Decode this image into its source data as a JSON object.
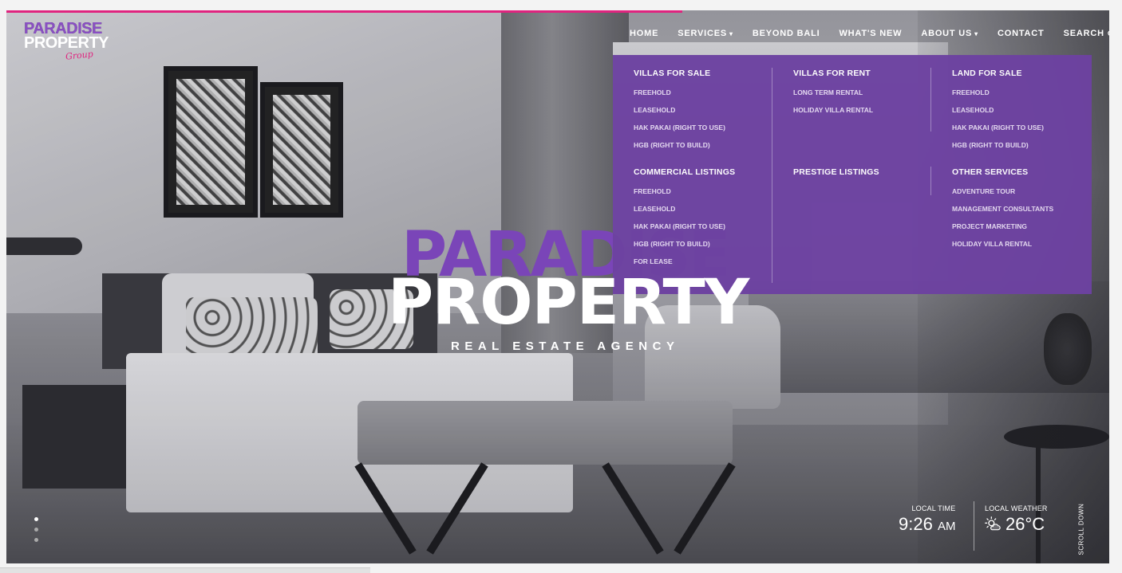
{
  "brand": {
    "line1": "PARADISE",
    "line2": "PROPERTY",
    "script": "Group"
  },
  "nav": {
    "items": [
      {
        "label": "HOME"
      },
      {
        "label": "SERVICES"
      },
      {
        "label": "BEYOND BALI"
      },
      {
        "label": "WHAT'S NEW"
      },
      {
        "label": "ABOUT US"
      },
      {
        "label": "CONTACT"
      },
      {
        "label": "SEARCH"
      }
    ]
  },
  "menu": {
    "villas_sale": {
      "title": "VILLAS FOR SALE",
      "links": [
        "FREEHOLD",
        "LEASEHOLD",
        "HAK PAKAI (RIGHT TO USE)",
        "HGB (RIGHT TO BUILD)"
      ]
    },
    "villas_rent": {
      "title": "VILLAS FOR RENT",
      "links": [
        "LONG TERM RENTAL",
        "HOLIDAY VILLA RENTAL"
      ]
    },
    "land_sale": {
      "title": "LAND FOR SALE",
      "links": [
        "FREEHOLD",
        "LEASEHOLD",
        "HAK PAKAI (RIGHT TO USE)",
        "HGB (RIGHT TO BUILD)"
      ]
    },
    "commercial": {
      "title": "COMMERCIAL LISTINGS",
      "links": [
        "FREEHOLD",
        "LEASEHOLD",
        "HAK PAKAI (RIGHT TO USE)",
        "HGB (RIGHT TO BUILD)",
        "FOR LEASE"
      ]
    },
    "prestige": {
      "title": "PRESTIGE LISTINGS"
    },
    "other": {
      "title": "OTHER SERVICES",
      "links": [
        "ADVENTURE TOUR",
        "MANAGEMENT CONSULTANTS",
        "PROJECT MARKETING",
        "HOLIDAY VILLA RENTAL"
      ]
    }
  },
  "hero": {
    "title_line1": "PARADISE",
    "title_line2": "PROPERTY",
    "subtitle": "REAL ESTATE AGENCY"
  },
  "widgets": {
    "time_label": "LOCAL TIME",
    "time_value": "9:26",
    "time_ampm": "AM",
    "weather_label": "LOCAL WEATHER",
    "weather_value": "26°C",
    "weather_icon": "partly-cloudy-icon"
  },
  "scroll_label": "SCROLL DOWN",
  "slides": {
    "count": 3,
    "active": 1
  },
  "colors": {
    "accent": "#6d42a1",
    "progress": "#e0247f",
    "brand_purple": "#7a45b8"
  }
}
